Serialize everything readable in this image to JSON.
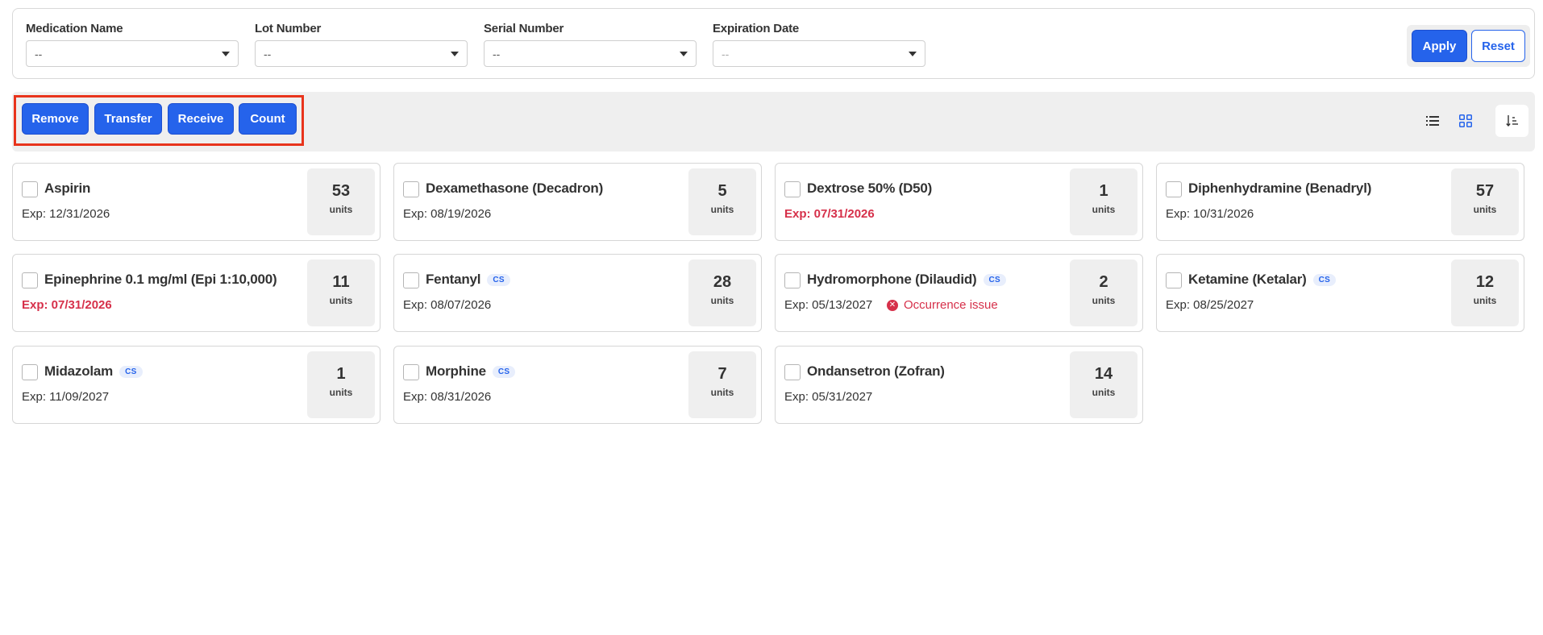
{
  "filters": {
    "medication_name": {
      "label": "Medication Name",
      "value": "--"
    },
    "lot_number": {
      "label": "Lot Number",
      "value": "--"
    },
    "serial_number": {
      "label": "Serial Number",
      "value": "--"
    },
    "expiration_date": {
      "label": "Expiration Date",
      "value": "--"
    },
    "apply_label": "Apply",
    "reset_label": "Reset"
  },
  "actions": {
    "remove_label": "Remove",
    "transfer_label": "Transfer",
    "receive_label": "Receive",
    "count_label": "Count"
  },
  "view": {
    "list_icon": "list-icon",
    "grid_icon": "grid-icon",
    "sort_icon": "sort-icon",
    "active_view": "grid"
  },
  "colors": {
    "primary": "#2563eb",
    "danger": "#d6304a",
    "highlight_border": "#e8341c"
  },
  "medications": [
    {
      "name": "Aspirin",
      "cs": "",
      "exp": "Exp: 12/31/2026",
      "expired": false,
      "issue": "",
      "qty": "53",
      "unit": "units"
    },
    {
      "name": "Dexamethasone (Decadron)",
      "cs": "",
      "exp": "Exp: 08/19/2026",
      "expired": false,
      "issue": "",
      "qty": "5",
      "unit": "units"
    },
    {
      "name": "Dextrose 50% (D50)",
      "cs": "",
      "exp": "Exp: 07/31/2026",
      "expired": true,
      "issue": "",
      "qty": "1",
      "unit": "units"
    },
    {
      "name": "Diphenhydramine (Benadryl)",
      "cs": "",
      "exp": "Exp: 10/31/2026",
      "expired": false,
      "issue": "",
      "qty": "57",
      "unit": "units"
    },
    {
      "name": "Epinephrine 0.1 mg/ml (Epi 1:10,000)",
      "cs": "",
      "exp": "Exp: 07/31/2026",
      "expired": true,
      "issue": "",
      "qty": "11",
      "unit": "units"
    },
    {
      "name": "Fentanyl",
      "cs": "CS",
      "exp": "Exp: 08/07/2026",
      "expired": false,
      "issue": "",
      "qty": "28",
      "unit": "units"
    },
    {
      "name": "Hydromorphone (Dilaudid)",
      "cs": "CS",
      "exp": "Exp: 05/13/2027",
      "expired": false,
      "issue": "Occurrence issue",
      "qty": "2",
      "unit": "units"
    },
    {
      "name": "Ketamine (Ketalar)",
      "cs": "CS",
      "exp": "Exp: 08/25/2027",
      "expired": false,
      "issue": "",
      "qty": "12",
      "unit": "units"
    },
    {
      "name": "Midazolam",
      "cs": "CS",
      "exp": "Exp: 11/09/2027",
      "expired": false,
      "issue": "",
      "qty": "1",
      "unit": "units"
    },
    {
      "name": "Morphine",
      "cs": "CS",
      "exp": "Exp: 08/31/2026",
      "expired": false,
      "issue": "",
      "qty": "7",
      "unit": "units"
    },
    {
      "name": "Ondansetron (Zofran)",
      "cs": "",
      "exp": "Exp: 05/31/2027",
      "expired": false,
      "issue": "",
      "qty": "14",
      "unit": "units"
    }
  ]
}
